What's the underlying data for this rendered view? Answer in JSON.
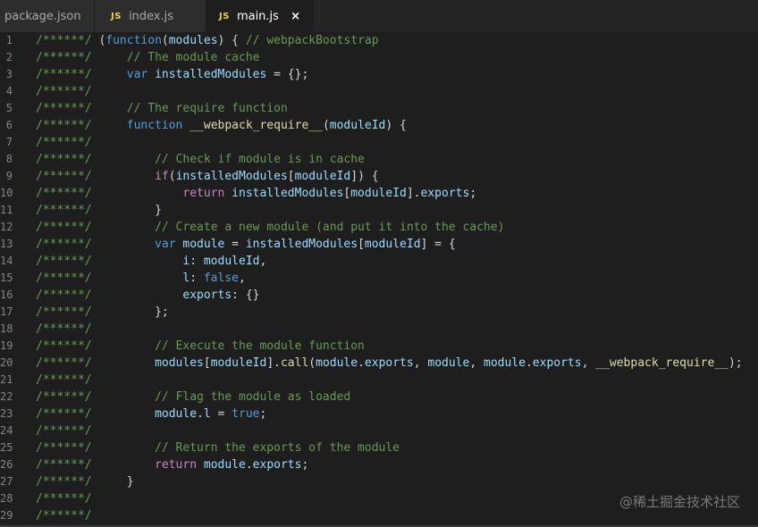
{
  "tabs": [
    {
      "label": "package.json",
      "badge": ""
    },
    {
      "label": "index.js",
      "badge": "JS"
    },
    {
      "label": "main.js",
      "badge": "JS",
      "active": true,
      "close": "×"
    }
  ],
  "watermark": "@稀土掘金技术社区",
  "code_lines": [
    {
      "n": "1",
      "tokens": [
        [
          "cm",
          "/******/ "
        ],
        [
          "pl",
          "("
        ],
        [
          "kw",
          "function"
        ],
        [
          "pl",
          "("
        ],
        [
          "vr",
          "modules"
        ],
        [
          "pl",
          ") { "
        ],
        [
          "cm",
          "// webpackBootstrap"
        ]
      ]
    },
    {
      "n": "2",
      "tokens": [
        [
          "cm",
          "/******/ "
        ],
        [
          "pl",
          "    "
        ],
        [
          "cm",
          "// The module cache"
        ]
      ]
    },
    {
      "n": "3",
      "tokens": [
        [
          "cm",
          "/******/ "
        ],
        [
          "pl",
          "    "
        ],
        [
          "kw",
          "var"
        ],
        [
          "pl",
          " "
        ],
        [
          "vr",
          "installedModules"
        ],
        [
          "pl",
          " = {};"
        ]
      ]
    },
    {
      "n": "4",
      "tokens": [
        [
          "cm",
          "/******/"
        ]
      ]
    },
    {
      "n": "5",
      "tokens": [
        [
          "cm",
          "/******/ "
        ],
        [
          "pl",
          "    "
        ],
        [
          "cm",
          "// The require function"
        ]
      ]
    },
    {
      "n": "6",
      "tokens": [
        [
          "cm",
          "/******/ "
        ],
        [
          "pl",
          "    "
        ],
        [
          "kw",
          "function"
        ],
        [
          "pl",
          " "
        ],
        [
          "fn",
          "__webpack_require__"
        ],
        [
          "pl",
          "("
        ],
        [
          "vr",
          "moduleId"
        ],
        [
          "pl",
          ") {"
        ]
      ]
    },
    {
      "n": "7",
      "tokens": [
        [
          "cm",
          "/******/"
        ]
      ]
    },
    {
      "n": "8",
      "tokens": [
        [
          "cm",
          "/******/ "
        ],
        [
          "pl",
          "        "
        ],
        [
          "cm",
          "// Check if module is in cache"
        ]
      ]
    },
    {
      "n": "9",
      "tokens": [
        [
          "cm",
          "/******/ "
        ],
        [
          "pl",
          "        "
        ],
        [
          "ctl",
          "if"
        ],
        [
          "pl",
          "("
        ],
        [
          "vr",
          "installedModules"
        ],
        [
          "pl",
          "["
        ],
        [
          "vr",
          "moduleId"
        ],
        [
          "pl",
          "]) {"
        ]
      ]
    },
    {
      "n": "10",
      "tokens": [
        [
          "cm",
          "/******/ "
        ],
        [
          "pl",
          "            "
        ],
        [
          "ctl",
          "return"
        ],
        [
          "pl",
          " "
        ],
        [
          "vr",
          "installedModules"
        ],
        [
          "pl",
          "["
        ],
        [
          "vr",
          "moduleId"
        ],
        [
          "pl",
          "]."
        ],
        [
          "vr",
          "exports"
        ],
        [
          "pl",
          ";"
        ]
      ]
    },
    {
      "n": "11",
      "tokens": [
        [
          "cm",
          "/******/ "
        ],
        [
          "pl",
          "        }"
        ]
      ]
    },
    {
      "n": "12",
      "tokens": [
        [
          "cm",
          "/******/ "
        ],
        [
          "pl",
          "        "
        ],
        [
          "cm",
          "// Create a new module (and put it into the cache)"
        ]
      ]
    },
    {
      "n": "13",
      "tokens": [
        [
          "cm",
          "/******/ "
        ],
        [
          "pl",
          "        "
        ],
        [
          "kw",
          "var"
        ],
        [
          "pl",
          " "
        ],
        [
          "vr",
          "module"
        ],
        [
          "pl",
          " = "
        ],
        [
          "vr",
          "installedModules"
        ],
        [
          "pl",
          "["
        ],
        [
          "vr",
          "moduleId"
        ],
        [
          "pl",
          "] = {"
        ]
      ]
    },
    {
      "n": "14",
      "tokens": [
        [
          "cm",
          "/******/ "
        ],
        [
          "pl",
          "            "
        ],
        [
          "vr",
          "i"
        ],
        [
          "pl",
          ": "
        ],
        [
          "vr",
          "moduleId"
        ],
        [
          "pl",
          ","
        ]
      ]
    },
    {
      "n": "15",
      "tokens": [
        [
          "cm",
          "/******/ "
        ],
        [
          "pl",
          "            "
        ],
        [
          "vr",
          "l"
        ],
        [
          "pl",
          ": "
        ],
        [
          "kw",
          "false"
        ],
        [
          "pl",
          ","
        ]
      ]
    },
    {
      "n": "16",
      "tokens": [
        [
          "cm",
          "/******/ "
        ],
        [
          "pl",
          "            "
        ],
        [
          "vr",
          "exports"
        ],
        [
          "pl",
          ": {}"
        ]
      ]
    },
    {
      "n": "17",
      "tokens": [
        [
          "cm",
          "/******/ "
        ],
        [
          "pl",
          "        };"
        ]
      ]
    },
    {
      "n": "18",
      "tokens": [
        [
          "cm",
          "/******/"
        ]
      ]
    },
    {
      "n": "19",
      "tokens": [
        [
          "cm",
          "/******/ "
        ],
        [
          "pl",
          "        "
        ],
        [
          "cm",
          "// Execute the module function"
        ]
      ]
    },
    {
      "n": "20",
      "tokens": [
        [
          "cm",
          "/******/ "
        ],
        [
          "pl",
          "        "
        ],
        [
          "vr",
          "modules"
        ],
        [
          "pl",
          "["
        ],
        [
          "vr",
          "moduleId"
        ],
        [
          "pl",
          "]."
        ],
        [
          "fn",
          "call"
        ],
        [
          "pl",
          "("
        ],
        [
          "vr",
          "module"
        ],
        [
          "pl",
          "."
        ],
        [
          "vr",
          "exports"
        ],
        [
          "pl",
          ", "
        ],
        [
          "vr",
          "module"
        ],
        [
          "pl",
          ", "
        ],
        [
          "vr",
          "module"
        ],
        [
          "pl",
          "."
        ],
        [
          "vr",
          "exports"
        ],
        [
          "pl",
          ", "
        ],
        [
          "fn",
          "__webpack_require__"
        ],
        [
          "pl",
          ");"
        ]
      ]
    },
    {
      "n": "21",
      "tokens": [
        [
          "cm",
          "/******/"
        ]
      ]
    },
    {
      "n": "22",
      "tokens": [
        [
          "cm",
          "/******/ "
        ],
        [
          "pl",
          "        "
        ],
        [
          "cm",
          "// Flag the module as loaded"
        ]
      ]
    },
    {
      "n": "23",
      "tokens": [
        [
          "cm",
          "/******/ "
        ],
        [
          "pl",
          "        "
        ],
        [
          "vr",
          "module"
        ],
        [
          "pl",
          "."
        ],
        [
          "vr",
          "l"
        ],
        [
          "pl",
          " = "
        ],
        [
          "kw",
          "true"
        ],
        [
          "pl",
          ";"
        ]
      ]
    },
    {
      "n": "24",
      "tokens": [
        [
          "cm",
          "/******/"
        ]
      ]
    },
    {
      "n": "25",
      "tokens": [
        [
          "cm",
          "/******/ "
        ],
        [
          "pl",
          "        "
        ],
        [
          "cm",
          "// Return the exports of the module"
        ]
      ]
    },
    {
      "n": "26",
      "tokens": [
        [
          "cm",
          "/******/ "
        ],
        [
          "pl",
          "        "
        ],
        [
          "ctl",
          "return"
        ],
        [
          "pl",
          " "
        ],
        [
          "vr",
          "module"
        ],
        [
          "pl",
          "."
        ],
        [
          "vr",
          "exports"
        ],
        [
          "pl",
          ";"
        ]
      ]
    },
    {
      "n": "27",
      "tokens": [
        [
          "cm",
          "/******/ "
        ],
        [
          "pl",
          "    }"
        ]
      ]
    },
    {
      "n": "28",
      "tokens": [
        [
          "cm",
          "/******/"
        ]
      ]
    },
    {
      "n": "29",
      "tokens": [
        [
          "cm",
          "/******/"
        ]
      ]
    }
  ]
}
